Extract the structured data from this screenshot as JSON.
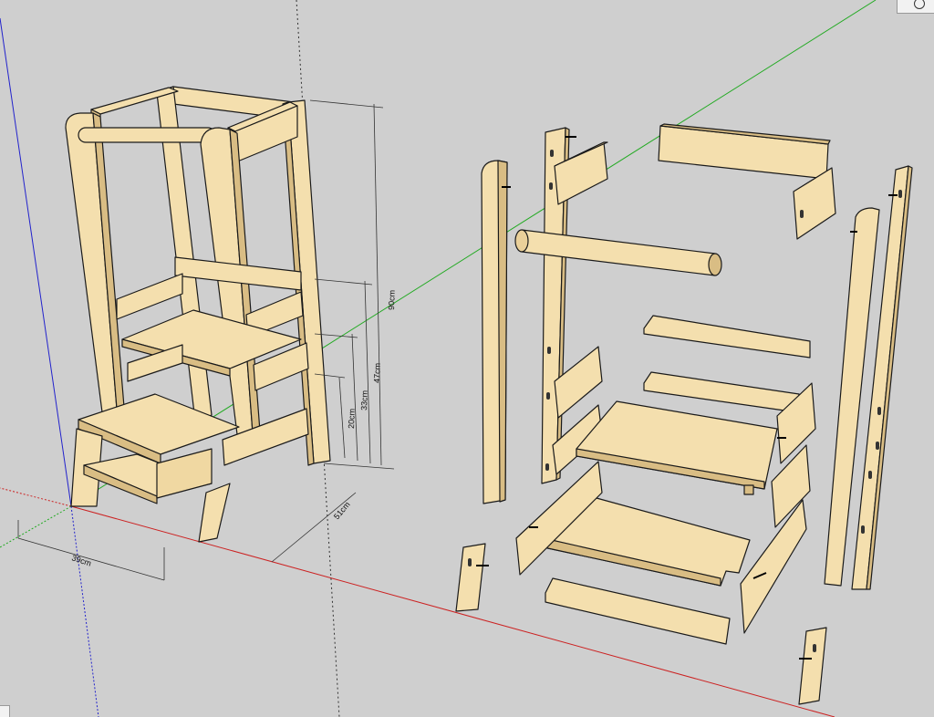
{
  "model": {
    "dimensions": {
      "height_total": "90cm",
      "height_step_top": "47cm",
      "height_step_mid": "33cm",
      "height_step_low": "20cm",
      "depth": "51cm",
      "width": "39cm"
    }
  },
  "colors": {
    "background": "#cfcfcf",
    "wood_face": "#f4dfae",
    "wood_side": "#d9bd84",
    "wood_dark": "#c7a86c",
    "outline": "#1a1a1a",
    "axis_red": "#cc2222",
    "axis_green": "#22aa22",
    "axis_blue": "#2222cc"
  },
  "icons": {
    "view_widget": "orbit-icon",
    "corner_widget": "corner-icon"
  }
}
